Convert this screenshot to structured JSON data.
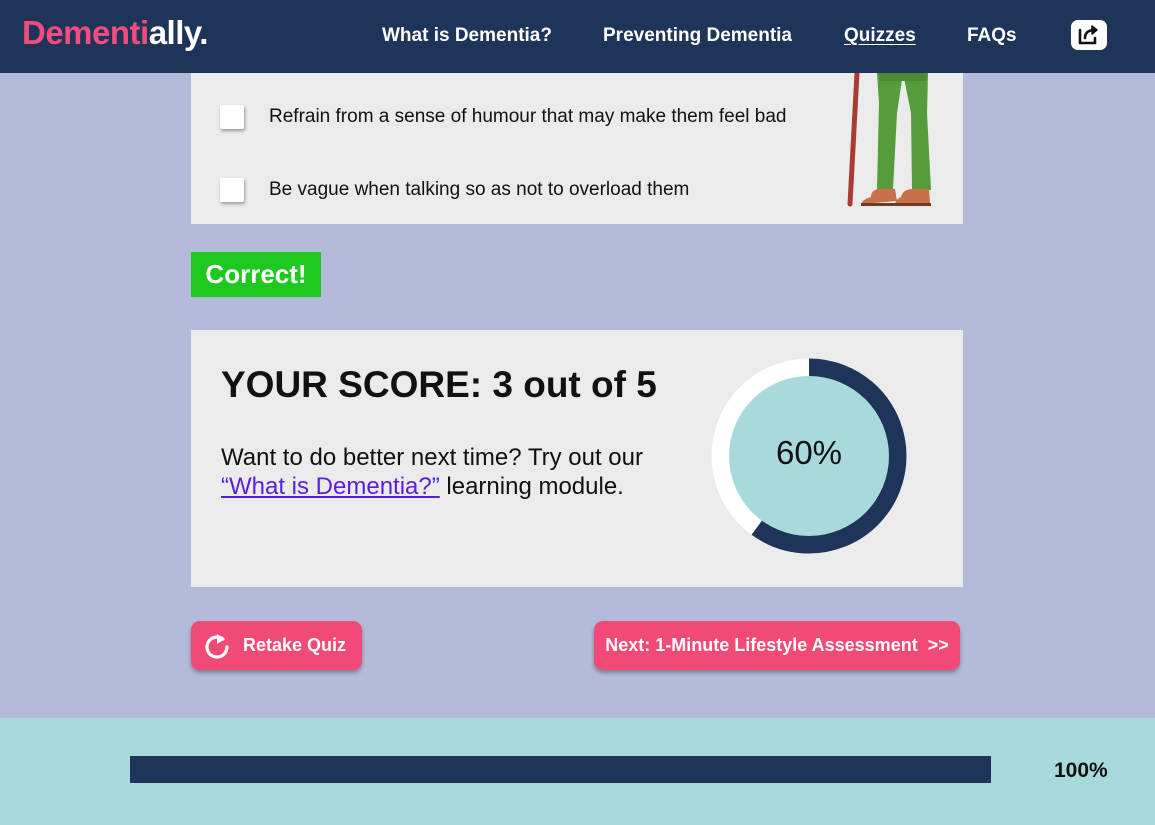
{
  "app": {
    "logo_part1": "Dementi",
    "logo_part2": "ally."
  },
  "nav": {
    "items": [
      {
        "label": "What is Dementia?"
      },
      {
        "label": "Preventing Dementia"
      },
      {
        "label": "Quizzes"
      },
      {
        "label": "FAQs"
      }
    ],
    "active": "Quizzes",
    "share_icon": "share-icon"
  },
  "question": {
    "options": [
      {
        "label": "Refrain from a sense of humour that may make them feel bad",
        "checked": false
      },
      {
        "label": "Be vague when talking so as not to overload them",
        "checked": false
      }
    ]
  },
  "feedback": {
    "label": "Correct!",
    "color": "#1ec81e"
  },
  "score": {
    "title": "YOUR SCORE: 3 out of 5",
    "message_before": "Want to do better next time? Try out our",
    "link_text": "“What is Dementia?”",
    "message_after": "learning module.",
    "percent_label": "60%",
    "fraction": 0.6
  },
  "buttons": {
    "retake": "Retake Quiz",
    "next": "Next: 1-Minute Lifestyle Assessment  >>"
  },
  "progress": {
    "label": "100%",
    "fraction": 1.0
  },
  "colors": {
    "navy": "#1e3459",
    "pink": "#f24a76",
    "teal": "#a8dadc",
    "lavender": "#b4bad9"
  }
}
